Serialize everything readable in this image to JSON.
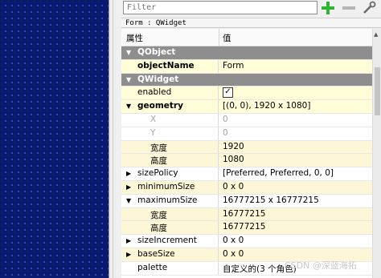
{
  "toolbar": {
    "filter_placeholder": "Filter",
    "add_icon": "plus-icon",
    "remove_icon": "minus-icon",
    "configure_icon": "wrench-icon"
  },
  "class_bar": "Form : QWidget",
  "header": {
    "property": "属性",
    "value": "值"
  },
  "rows": [
    {
      "name": "QObject",
      "value": ""
    },
    {
      "name": "objectName",
      "value": "Form"
    },
    {
      "name": "QWidget",
      "value": ""
    },
    {
      "name": "enabled",
      "value": ""
    },
    {
      "name": "geometry",
      "value": "[(0, 0), 1920 x 1080]"
    },
    {
      "name": "X",
      "value": "0"
    },
    {
      "name": "Y",
      "value": "0"
    },
    {
      "name": "宽度",
      "value": "1920"
    },
    {
      "name": "高度",
      "value": "1080"
    },
    {
      "name": "sizePolicy",
      "value": "[Preferred, Preferred, 0, 0]"
    },
    {
      "name": "minimumSize",
      "value": "0 x 0"
    },
    {
      "name": "maximumSize",
      "value": "16777215 x 16777215"
    },
    {
      "name": "宽度",
      "value": "16777215"
    },
    {
      "name": "高度",
      "value": "16777215"
    },
    {
      "name": "sizeIncrement",
      "value": "0 x 0"
    },
    {
      "name": "baseSize",
      "value": "0 x 0"
    },
    {
      "name": "palette",
      "value": "自定义的(3 个角色)"
    }
  ],
  "enabled_checked": true,
  "watermark": "CSDN @深蓝海拓",
  "colors": {
    "group_bg": "#8e8e8e",
    "selected_bg": "#fffcd8",
    "canvas_bg": "#0a1a6e"
  }
}
